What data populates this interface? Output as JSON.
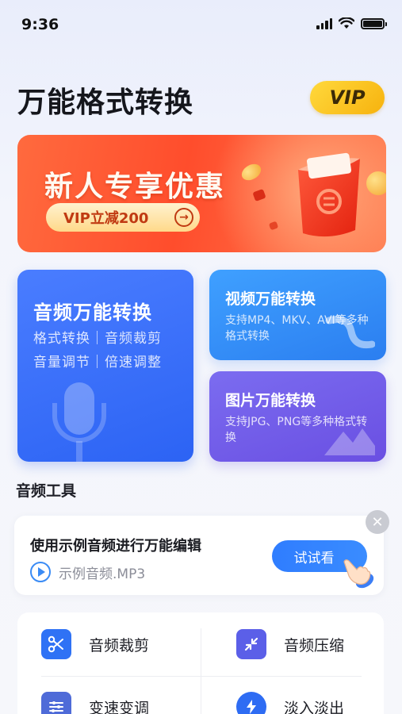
{
  "status": {
    "time": "9:36"
  },
  "header": {
    "title": "万能格式转换",
    "vip_label": "VIP"
  },
  "banner": {
    "title": "新人专享优惠",
    "button_label": "VIP立减200",
    "button_arrow": "→"
  },
  "features": {
    "audio": {
      "title": "音频万能转换",
      "line1": "格式转换｜音频裁剪",
      "line2": "音量调节｜倍速调整"
    },
    "video": {
      "title": "视频万能转换",
      "desc": "支持MP4、MKV、AVI等多种格式转换"
    },
    "image": {
      "title": "图片万能转换",
      "desc": "支持JPG、PNG等多种格式转换"
    }
  },
  "section": {
    "title": "音频工具"
  },
  "sample": {
    "title": "使用示例音频进行万能编辑",
    "file_name": "示例音频.MP3",
    "button_label": "试试看",
    "close_symbol": "✕"
  },
  "tools": [
    {
      "label": "音频裁剪",
      "icon": "scissors-icon",
      "color": "#2f72f5"
    },
    {
      "label": "音频压缩",
      "icon": "compress-icon",
      "color": "#5b5fe8"
    },
    {
      "label": "变速变调",
      "icon": "speed-icon",
      "color": "#4f6bd8"
    },
    {
      "label": "淡入淡出",
      "icon": "fade-icon",
      "color": "#2e6cf3"
    }
  ],
  "colors": {
    "accent": "#2f7dff",
    "banner": "#ff4d2c",
    "vip": "#ffd93c"
  }
}
